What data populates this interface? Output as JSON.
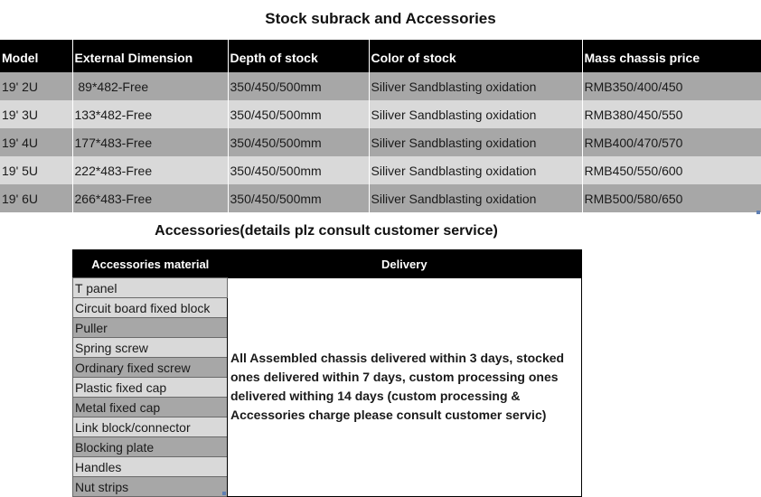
{
  "title": "Stock subrack and Accessories",
  "stock_table": {
    "headers": [
      "Model",
      "External Dimension",
      "Depth of stock",
      "Color of stock",
      "Mass chassis price"
    ],
    "rows": [
      [
        "19' 2U",
        " 89*482-Free",
        "350/450/500mm",
        "Siliver Sandblasting oxidation",
        "RMB350/400/450"
      ],
      [
        "19' 3U",
        "133*482-Free",
        "350/450/500mm",
        "Siliver Sandblasting oxidation",
        "RMB380/450/550"
      ],
      [
        "19' 4U",
        "177*483-Free",
        "350/450/500mm",
        "Siliver Sandblasting oxidation",
        "RMB400/470/570"
      ],
      [
        "19' 5U",
        "222*483-Free",
        "350/450/500mm",
        "Siliver Sandblasting oxidation",
        "RMB450/550/600"
      ],
      [
        "19' 6U",
        "266*483-Free",
        "350/450/500mm",
        "Siliver Sandblasting oxidation",
        "RMB500/580/650"
      ]
    ]
  },
  "accessories_title": "Accessories(details plz consult customer service)",
  "accessories_table": {
    "headers": [
      "Accessories material",
      "Delivery"
    ],
    "items": [
      "T panel",
      "Circuit board fixed block",
      "Puller",
      "Spring screw",
      "Ordinary fixed screw",
      "Plastic fixed cap",
      "Metal fixed cap",
      "Link block/connector",
      "Blocking plate",
      "Handles",
      "Nut strips"
    ],
    "delivery_text": "All Assembled chassis delivered within 3 days, stocked ones delivered within 7 days, custom processing ones delivered withing 14 days (custom processing & Accessories charge please consult customer servic)"
  }
}
